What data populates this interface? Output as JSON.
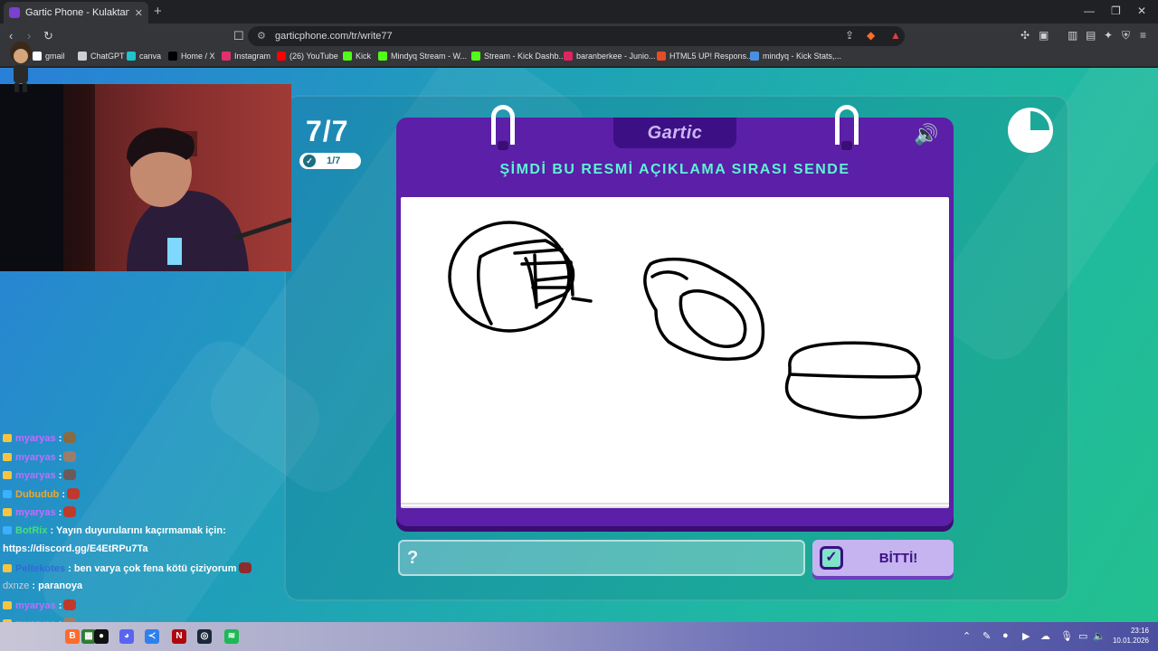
{
  "browser": {
    "tab_title": "Gartic Phone - Kulaktan Kulağa",
    "url": "garticphone.com/tr/write77",
    "bookmarks": [
      {
        "label": "gmail",
        "color": "#ffffff"
      },
      {
        "label": "ChatGPT",
        "color": "#cfcfcf"
      },
      {
        "label": "canva",
        "color": "#20c4cb"
      },
      {
        "label": "Home / X",
        "color": "#000000"
      },
      {
        "label": "Instagram",
        "color": "#e1306c"
      },
      {
        "label": "(26) YouTube",
        "color": "#ff0000"
      },
      {
        "label": "Kick",
        "color": "#53fc18"
      },
      {
        "label": "Mindyq Stream - W...",
        "color": "#53fc18"
      },
      {
        "label": "Stream - Kick Dashb...",
        "color": "#53fc18"
      },
      {
        "label": "baranberkee - Junio...",
        "color": "#e0245e"
      },
      {
        "label": "HTML5 UP! Respons...",
        "color": "#e44d26"
      },
      {
        "label": "mindyq - Kick Stats,...",
        "color": "#4a90e2"
      }
    ]
  },
  "game": {
    "round": "7/7",
    "progress": "1/7",
    "logo": "Gartic",
    "prompt": "ŞİMDİ BU RESMİ AÇIKLAMA SIRASI SENDE",
    "answer_placeholder": "?",
    "done_label": "BİTTİ!",
    "timer_remaining_fraction": 0.75,
    "colors": {
      "card": "#5b1fa8",
      "accent": "#5ef3d3",
      "done_bg": "#c5b4f0"
    }
  },
  "chat": [
    {
      "user": "myaryas",
      "sep": " :",
      "text": "",
      "style": "",
      "badge": "b1"
    },
    {
      "user": "myaryas",
      "sep": " :",
      "text": "",
      "style": "",
      "badge": "b1"
    },
    {
      "user": "myaryas",
      "sep": " :",
      "text": "",
      "style": "",
      "badge": "b1"
    },
    {
      "user": "Dubudub",
      "sep": " :",
      "text": "",
      "style": "orange",
      "badge": "b2"
    },
    {
      "user": "myaryas",
      "sep": " :",
      "text": "",
      "style": "",
      "badge": "b1"
    },
    {
      "user": "BotRix",
      "sep": " :",
      "text": " Yayın duyurularını kaçırmamak için:",
      "style": "green",
      "badge": "b2"
    },
    {
      "user": "",
      "sep": "",
      "text": "https://discord.gg/E4EtRPu7Ta",
      "style": "",
      "badge": ""
    },
    {
      "user": "Peltekotes",
      "sep": " :",
      "text": " ben varya çok fena kötü çiziyorum",
      "style": "dark",
      "badge": "b1"
    },
    {
      "user": "dxnze",
      "sep": " :",
      "text": " paranoya",
      "style": "gray",
      "badge": ""
    },
    {
      "user": "myaryas",
      "sep": " :",
      "text": "",
      "style": "",
      "badge": "b1"
    },
    {
      "user": "myaryas",
      "sep": " :",
      "text": "",
      "style": "",
      "badge": "b1"
    }
  ],
  "taskbar": {
    "time": "23:16",
    "date": "10.01.2026"
  }
}
